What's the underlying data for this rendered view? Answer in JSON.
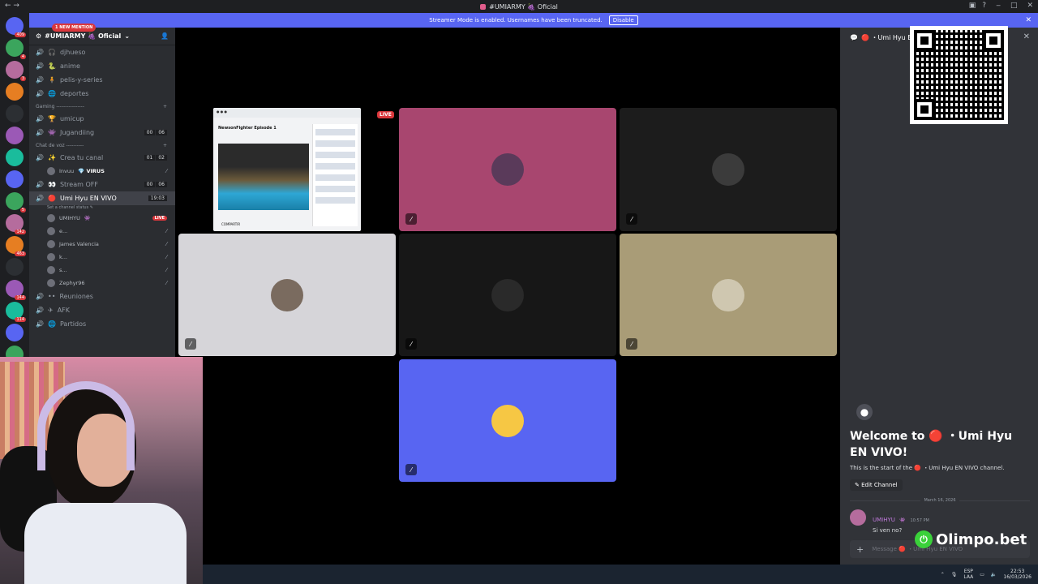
{
  "window": {
    "title": "#UMIARMY 🍇 Oficial",
    "controls": [
      "‒",
      "□",
      "✕"
    ]
  },
  "banner": {
    "text": "Streamer Mode is enabled. Usernames have been truncated.",
    "button": "Disable"
  },
  "guild_badges": [
    "409",
    "4",
    "3",
    "",
    "",
    "",
    "",
    "",
    "5",
    "142",
    "463",
    "",
    "144",
    "114",
    "",
    "123",
    "166",
    "768",
    "",
    "871"
  ],
  "server": {
    "name": "#UMIARMY 🍇 Oficial"
  },
  "mention_pill": "1 NEW MENTION",
  "channels_top": [
    {
      "emoji": "🎧",
      "name": "djhueso"
    },
    {
      "emoji": "🐍",
      "name": "anime"
    },
    {
      "emoji": "🧍",
      "name": "pelis-y-series"
    },
    {
      "emoji": "🌐",
      "name": "deportes"
    }
  ],
  "category_gaming": "Gaming ----------------",
  "channels_gaming": [
    {
      "emoji": "🏆",
      "name": "umicup"
    },
    {
      "emoji": "👾",
      "name": "Jugandiing",
      "counts": [
        "00",
        "06"
      ]
    }
  ],
  "category_voice": "Chat de voz ----------",
  "channels_voice_1": [
    {
      "emoji": "✨",
      "name": "Crea tu canal",
      "counts": [
        "01",
        "02"
      ]
    }
  ],
  "voice_user_1": {
    "name": "Invuu",
    "tag": "💎 VIRUS"
  },
  "channels_voice_2": [
    {
      "emoji": "👀",
      "name": "Stream OFF",
      "counts": [
        "00",
        "06"
      ]
    }
  ],
  "active_channel": {
    "emoji": "🔴",
    "name": "Umi Hyu EN VIVO",
    "time": "19:03",
    "status": "Set a channel status ✎"
  },
  "voice_users": [
    {
      "name": "UMIHYU",
      "badge": "👾",
      "live": "LIVE"
    },
    {
      "name": "e..."
    },
    {
      "name": "James Valencia"
    },
    {
      "name": "k..."
    },
    {
      "name": "s..."
    },
    {
      "name": "Zephyr96"
    }
  ],
  "channels_bottom": [
    {
      "emoji": "••",
      "name": "Reuniones"
    },
    {
      "emoji": "✈",
      "name": "AFK"
    },
    {
      "emoji": "🌐",
      "name": "Partidos"
    }
  ],
  "stage": {
    "live_label": "LIVE",
    "screen": {
      "page_title": "NewsonFighter Episode 1",
      "footer": "COMPARTIR"
    },
    "tiles": [
      {
        "name": "tile-umihyu",
        "bg": "#a8466f",
        "avatar": "#5a3a5a"
      },
      {
        "name": "tile-dark-user",
        "bg": "#1c1c1c",
        "avatar": "#3b3b3b"
      },
      {
        "name": "tile-james",
        "bg": "#d6d5d9",
        "avatar": "#7a6b5f"
      },
      {
        "name": "tile-user-e",
        "bg": "#171717",
        "avatar": "#2a2a2a"
      },
      {
        "name": "tile-dog",
        "bg": "#a99c77",
        "avatar": "#cfc7b0"
      },
      {
        "name": "tile-zephyr",
        "bg": "#5865f2",
        "avatar": "#f6c744"
      }
    ]
  },
  "chat": {
    "header": "🔴 ・Umi Hyu EN",
    "welcome": "Welcome to 🔴 ・Umi Hyu EN VIVO!",
    "subtitle": "This is the start of the 🔴 ・Umi Hyu EN VIVO channel.",
    "edit_button": "Edit Channel",
    "date": "March 16, 2026",
    "message": {
      "author": "UMIHYU",
      "badge": "👾",
      "time": "10:57 PM",
      "text": "Si ven no?"
    },
    "input_placeholder": "Message 🔴 ・Umi Hyu EN VIVO"
  },
  "sponsor": "Olimpo.bet",
  "taskbar": {
    "lang": "ESP",
    "lang2": "LAA",
    "time": "22:53",
    "date": "16/03/2026"
  }
}
